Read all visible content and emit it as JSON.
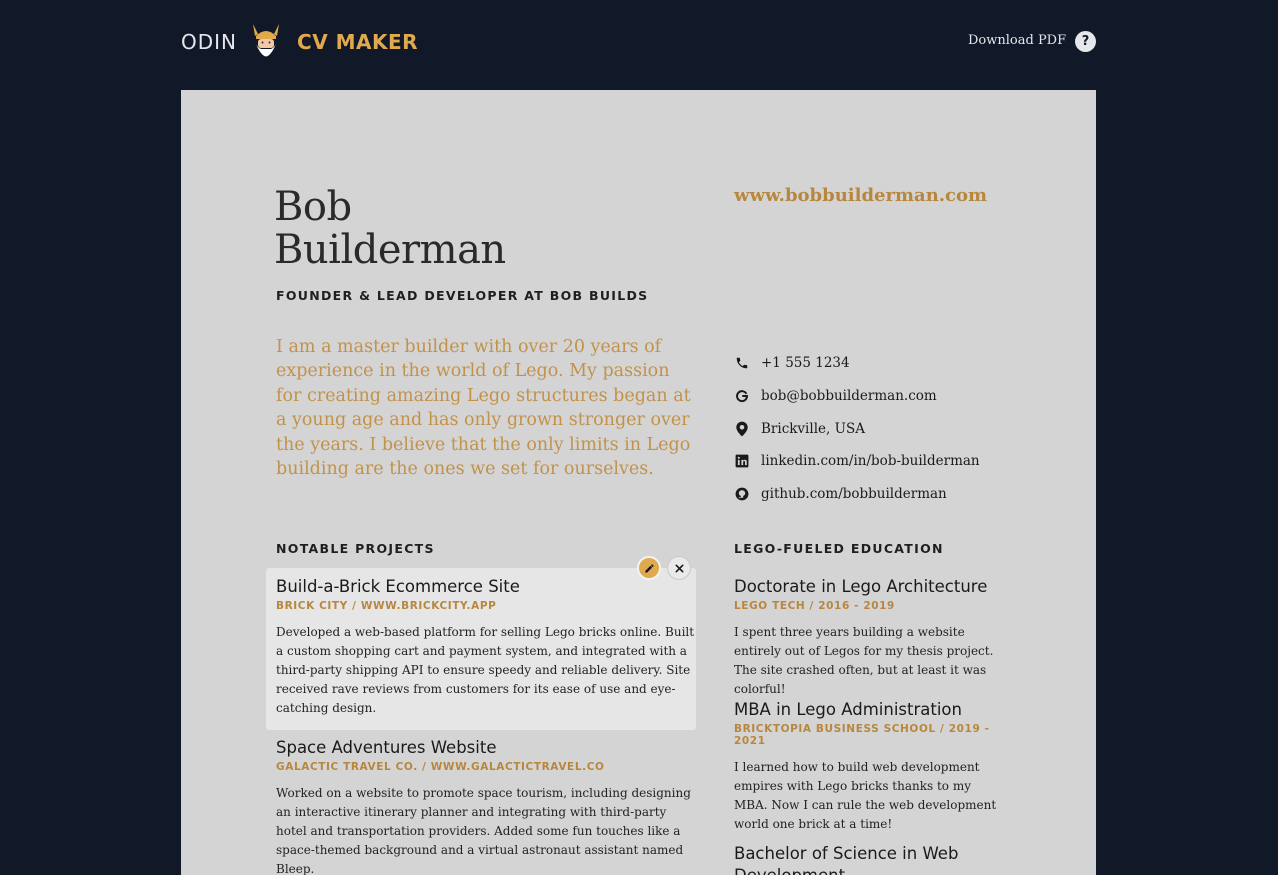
{
  "header": {
    "brand_left": "ODIN",
    "brand_right": "CV MAKER",
    "download_label": "Download PDF",
    "help_label": "?"
  },
  "cv": {
    "first_name": "Bob",
    "last_name": "Builderman",
    "role": "FOUNDER & LEAD DEVELOPER AT BOB BUILDS",
    "website": "www.bobbuilderman.com",
    "summary": "I am a master builder with over 20 years of experience in the world of Lego. My passion for creating amazing Lego structures began at a young age and has only grown stronger over the years. I believe that the only limits in Lego building are the ones we set for ourselves.",
    "contacts": [
      {
        "icon": "phone-icon",
        "text": "+1 555 1234"
      },
      {
        "icon": "google-icon",
        "text": "bob@bobbuilderman.com"
      },
      {
        "icon": "location-pin-icon",
        "text": "Brickville, USA"
      },
      {
        "icon": "linkedin-icon",
        "text": "linkedin.com/in/bob-builderman"
      },
      {
        "icon": "github-icon",
        "text": "github.com/bobbuilderman"
      }
    ],
    "projects_title": "NOTABLE PROJECTS",
    "projects": [
      {
        "title": "Build-a-Brick Ecommerce Site",
        "subtitle": "BRICK CITY / WWW.BRICKCITY.APP",
        "description": "Developed a web-based platform for selling Lego bricks online. Built a custom shopping cart and payment system, and integrated with a third-party shipping API to ensure speedy and reliable delivery. Site received rave reviews from customers for its ease of use and eye-catching design."
      },
      {
        "title": "Space Adventures Website",
        "subtitle": "GALACTIC TRAVEL CO. / WWW.GALACTICTRAVEL.CO",
        "description": "Worked on a website to promote space tourism, including designing an interactive itinerary planner and integrating with third-party hotel and transportation providers. Added some fun touches like a space-themed background and a virtual astronaut assistant named Bleep."
      }
    ],
    "education_title": "LEGO-FUELED EDUCATION",
    "education": [
      {
        "title": "Doctorate in Lego Architecture",
        "subtitle": "LEGO TECH / 2016 - 2019",
        "description": "I spent three years building a website entirely out of Legos for my thesis project. The site crashed often, but at least it was colorful!"
      },
      {
        "title": "MBA in Lego Administration",
        "subtitle": "BRICKTOPIA BUSINESS SCHOOL / 2019 - 2021",
        "description": "I learned how to build web development empires with Lego bricks thanks to my MBA. Now I can rule the web development world one brick at a time!"
      },
      {
        "title": "Bachelor of Science in Web Development",
        "subtitle": "",
        "description": ""
      }
    ]
  },
  "colors": {
    "background": "#111827",
    "paper": "#d4d4d4",
    "accent": "#e0a94d",
    "accent_text": "#b8873e"
  }
}
